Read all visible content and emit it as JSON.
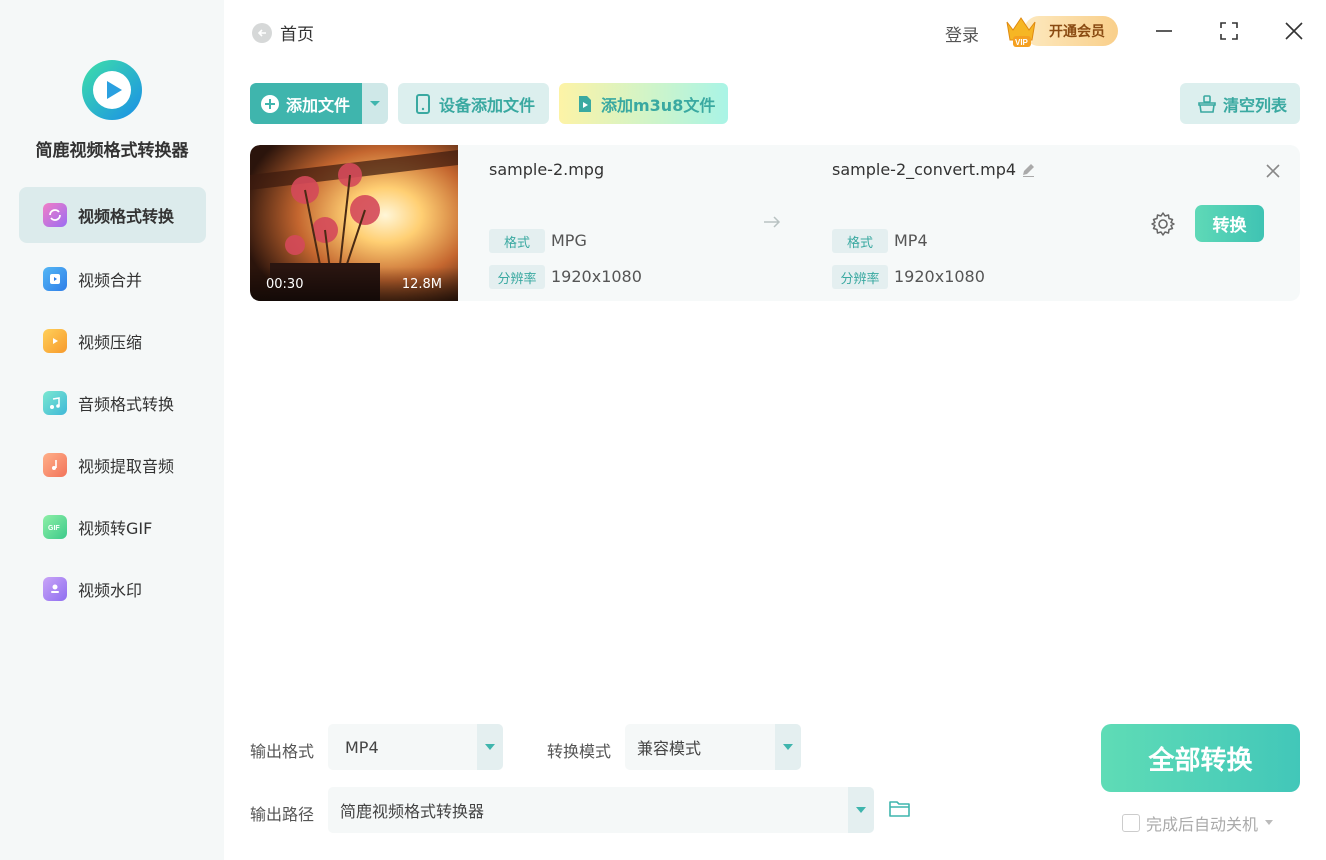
{
  "sidebar": {
    "app_name": "简鹿视频格式转换器",
    "items": [
      {
        "label": "视频格式转换",
        "icon": "video-convert-icon",
        "active": true
      },
      {
        "label": "视频合并",
        "icon": "video-merge-icon",
        "active": false
      },
      {
        "label": "视频压缩",
        "icon": "video-compress-icon",
        "active": false
      },
      {
        "label": "音频格式转换",
        "icon": "audio-convert-icon",
        "active": false
      },
      {
        "label": "视频提取音频",
        "icon": "extract-audio-icon",
        "active": false
      },
      {
        "label": "视频转GIF",
        "icon": "gif-icon",
        "active": false
      },
      {
        "label": "视频水印",
        "icon": "watermark-icon",
        "active": false
      }
    ]
  },
  "header": {
    "back_label": "首页",
    "login_label": "登录",
    "vip_badge": "VIP",
    "vip_label": "开通会员"
  },
  "toolbar": {
    "add_file": "添加文件",
    "device_add": "设备添加文件",
    "add_m3u8": "添加m3u8文件",
    "clear_list": "清空列表"
  },
  "file": {
    "duration": "00:30",
    "size": "12.8M",
    "source_name": "sample-2.mpg",
    "output_name": "sample-2_convert.mp4",
    "format_tag": "格式",
    "resolution_tag": "分辨率",
    "source_format": "MPG",
    "source_resolution": "1920x1080",
    "output_format": "MP4",
    "output_resolution": "1920x1080",
    "convert_label": "转换"
  },
  "bottom": {
    "output_format_label": "输出格式",
    "output_format_value": "MP4",
    "mode_label": "转换模式",
    "mode_value": "兼容模式",
    "path_label": "输出路径",
    "path_value": "简鹿视频格式转换器",
    "convert_all": "全部转换",
    "auto_shutdown": "完成后自动关机"
  },
  "colors": {
    "accent": "#3fb5ad",
    "sidebar_bg": "#f5f8f8",
    "active_nav": "#dcebec"
  }
}
